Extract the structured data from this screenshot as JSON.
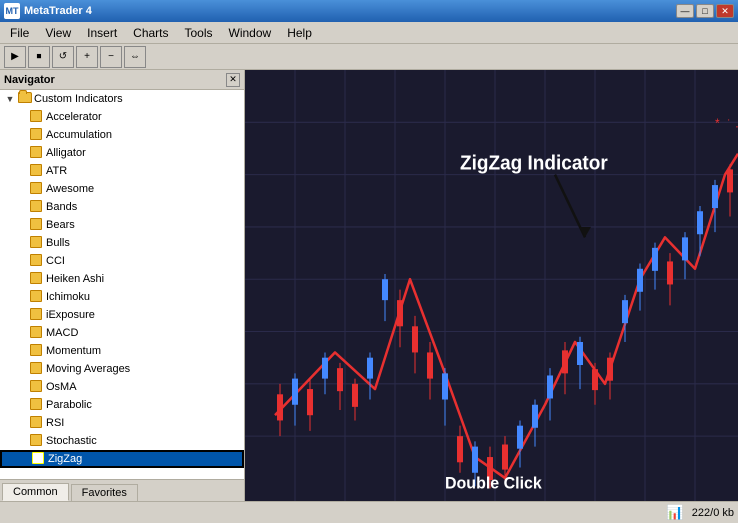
{
  "app": {
    "title": "MetaTrader 4",
    "icon_text": "MT"
  },
  "title_bar": {
    "buttons": {
      "minimize": "—",
      "maximize": "□",
      "close": "✕"
    }
  },
  "menu": {
    "items": [
      "File",
      "View",
      "Insert",
      "Charts",
      "Tools",
      "Window",
      "Help"
    ]
  },
  "navigator": {
    "title": "Navigator",
    "tree": {
      "root": {
        "label": "Custom Indicators",
        "items": [
          "Accelerator",
          "Accumulation",
          "Alligator",
          "ATR",
          "Awesome",
          "Bands",
          "Bears",
          "Bulls",
          "CCI",
          "Heiken Ashi",
          "Ichimoku",
          "iExposure",
          "MACD",
          "Momentum",
          "Moving Averages",
          "OsMA",
          "Parabolic",
          "RSI",
          "Stochastic",
          "ZigZag"
        ]
      }
    },
    "tabs": [
      "Common",
      "Favorites"
    ]
  },
  "chart": {
    "annotation": "ZigZag Indicator",
    "double_click": "Double Click"
  },
  "status_bar": {
    "memory": "222/0 kb"
  }
}
